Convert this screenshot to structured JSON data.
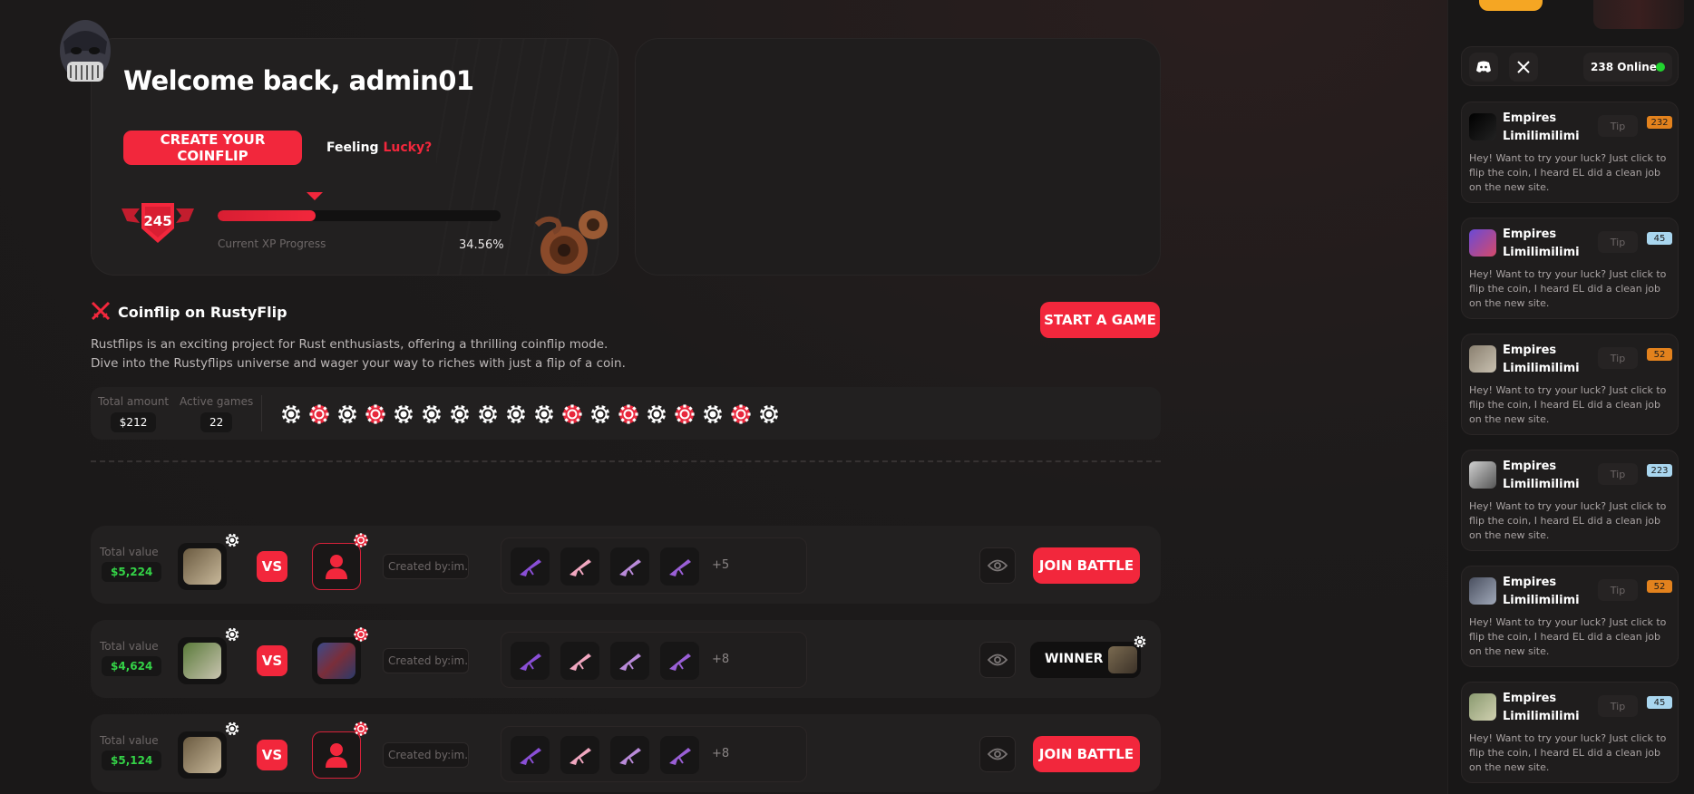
{
  "colors": {
    "accent": "#f2273c",
    "green": "#34d347",
    "online": "#21d32f",
    "level_orange": "#e3821d",
    "level_blue": "#a9d6ef"
  },
  "welcome": {
    "title": "Welcome back, admin01",
    "create_button": "CREATE YOUR COINFLIP",
    "feeling": "Feeling",
    "lucky": "Lucky?",
    "level": "245",
    "xp_label": "Current XP Progress",
    "xp_percent": "34.56%",
    "xp_value": 34.56
  },
  "section": {
    "title": "Coinflip on RustyFlip",
    "desc1": "Rustflips is an exciting project for Rust enthusiasts, offering a thrilling coinflip mode.",
    "desc2": "Dive into the Rustyflips universe and wager your way to riches with just a flip of a coin.",
    "start_button": "START A GAME"
  },
  "stats": {
    "total_label": "Total amount",
    "total_value": "$212",
    "active_label": "Active games",
    "active_value": "22",
    "chips": [
      "white",
      "red",
      "white",
      "red",
      "white",
      "white",
      "white",
      "white",
      "white",
      "white",
      "red",
      "white",
      "red",
      "white",
      "red",
      "white",
      "red",
      "white"
    ]
  },
  "games": [
    {
      "tv_label": "Total value",
      "tv_value": "$5,224",
      "created": "Created by:im...",
      "more": "+5",
      "action": "JOIN BATTLE",
      "opponent": "empty"
    },
    {
      "tv_label": "Total value",
      "tv_value": "$4,624",
      "created": "Created by:im...",
      "more": "+8",
      "action": "WINNER",
      "opponent": "filled"
    },
    {
      "tv_label": "Total value",
      "tv_value": "$5,124",
      "created": "Created by:im...",
      "more": "+8",
      "action": "JOIN BATTLE",
      "opponent": "empty"
    }
  ],
  "vs_label": "VS",
  "sidebar": {
    "online": "238 Online",
    "messages": [
      {
        "name": "Empires Limilimilimi",
        "tip": "Tip",
        "level": "232",
        "level_color": "orange",
        "text": "Hey! Want to try your luck? Just click to flip the coin, I heard EL did a clean job on the new site."
      },
      {
        "name": "Empires Limilimilimi",
        "tip": "Tip",
        "level": "45",
        "level_color": "blue",
        "text": "Hey! Want to try your luck? Just click to flip the coin, I heard EL did a clean job on the new site."
      },
      {
        "name": "Empires Limilimilimi",
        "tip": "Tip",
        "level": "52",
        "level_color": "orange",
        "text": "Hey! Want to try your luck? Just click to flip the coin, I heard EL did a clean job on the new site."
      },
      {
        "name": "Empires Limilimilimi",
        "tip": "Tip",
        "level": "223",
        "level_color": "blue",
        "text": "Hey! Want to try your luck? Just click to flip the coin, I heard EL did a clean job on the new site."
      },
      {
        "name": "Empires Limilimilimi",
        "tip": "Tip",
        "level": "52",
        "level_color": "orange",
        "text": "Hey! Want to try your luck? Just click to flip the coin, I heard EL did a clean job on the new site."
      },
      {
        "name": "Empires Limilimilimi",
        "tip": "Tip",
        "level": "45",
        "level_color": "blue",
        "text": "Hey! Want to try your luck? Just click to flip the coin, I heard EL did a clean job on the new site."
      }
    ]
  }
}
